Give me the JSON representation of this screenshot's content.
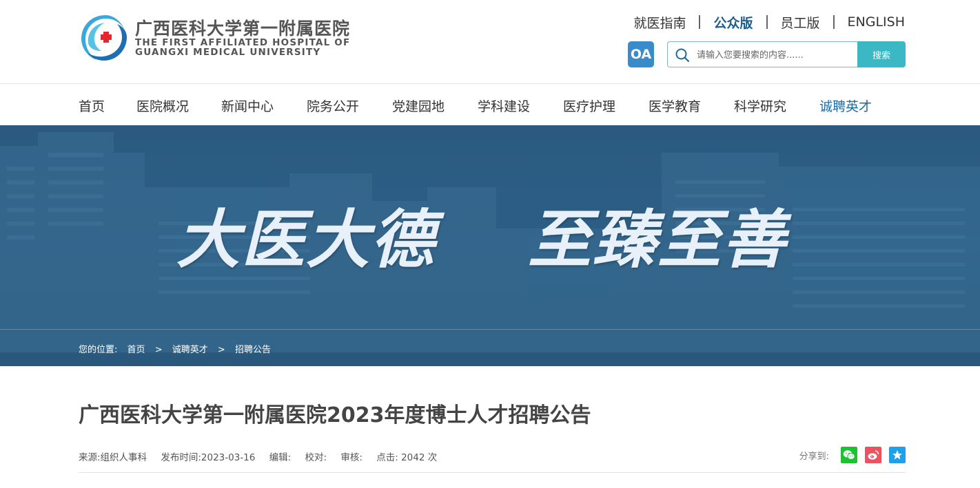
{
  "header": {
    "logo_cn": "广西医科大学第一附属医院",
    "logo_en_line1": "THE FIRST AFFILIATED HOSPITAL OF",
    "logo_en_line2": "GUANGXI MEDICAL UNIVERSITY",
    "top_links": [
      {
        "label": "就医指南",
        "active": false
      },
      {
        "label": "公众版",
        "active": true
      },
      {
        "label": "员工版",
        "active": false
      },
      {
        "label": "ENGLISH",
        "active": false
      }
    ],
    "oa_label": "OA",
    "search": {
      "placeholder": "请输入您要搜索的内容......",
      "button_label": "搜索"
    }
  },
  "main_nav": [
    {
      "label": "首页",
      "active": false
    },
    {
      "label": "医院概况",
      "active": false
    },
    {
      "label": "新闻中心",
      "active": false
    },
    {
      "label": "院务公开",
      "active": false
    },
    {
      "label": "党建园地",
      "active": false
    },
    {
      "label": "学科建设",
      "active": false
    },
    {
      "label": "医疗护理",
      "active": false
    },
    {
      "label": "医学教育",
      "active": false
    },
    {
      "label": "科学研究",
      "active": false
    },
    {
      "label": "诚聘英才",
      "active": true
    }
  ],
  "banner": {
    "slogan_part1": "大医大德",
    "slogan_part2": "至臻至善"
  },
  "breadcrumb": {
    "prefix": "您的位置:",
    "items": [
      "首页",
      "诚聘英才",
      "招聘公告"
    ],
    "separator": ">"
  },
  "article": {
    "title": "广西医科大学第一附属医院2023年度博士人才招聘公告",
    "meta": {
      "source": "来源:组织人事科",
      "date": "发布时间:2023-03-16",
      "editor": "编辑:",
      "proofread": "校对:",
      "review": "审核:",
      "clicks": "点击: 2042 次"
    },
    "share_label": "分享到:"
  },
  "colors": {
    "brand_blue": "#1d6a9e",
    "search_button": "#3cb8c4",
    "oa_button": "#3a8bc9",
    "banner_bg": "#2d5f86",
    "wechat": "#1ec131",
    "weibo": "#e9525e",
    "qzone": "#1fa0e8"
  },
  "icons": {
    "search": "search-icon",
    "share_wechat": "wechat-icon",
    "share_weibo": "weibo-icon",
    "share_qzone": "qzone-icon"
  }
}
